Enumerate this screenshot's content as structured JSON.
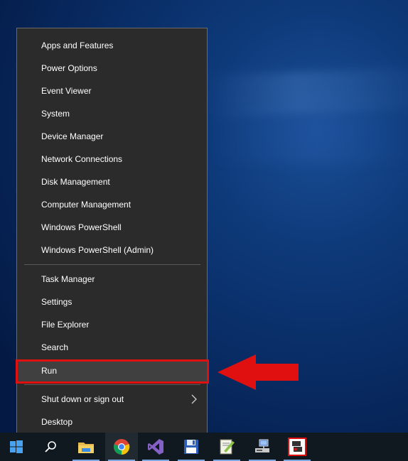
{
  "context_menu": {
    "items": [
      {
        "label": "Apps and Features"
      },
      {
        "label": "Power Options"
      },
      {
        "label": "Event Viewer"
      },
      {
        "label": "System"
      },
      {
        "label": "Device Manager"
      },
      {
        "label": "Network Connections"
      },
      {
        "label": "Disk Management"
      },
      {
        "label": "Computer Management"
      },
      {
        "label": "Windows PowerShell"
      },
      {
        "label": "Windows PowerShell (Admin)"
      },
      {
        "label": "Task Manager"
      },
      {
        "label": "Settings"
      },
      {
        "label": "File Explorer"
      },
      {
        "label": "Search"
      },
      {
        "label": "Run"
      },
      {
        "label": "Shut down or sign out"
      },
      {
        "label": "Desktop"
      }
    ],
    "highlighted_item": "Run",
    "submenu_icon": "chevron-right-icon"
  },
  "annotation": {
    "highlight_color": "#e01010",
    "arrow_icon": "red-left-arrow-icon"
  },
  "taskbar": {
    "buttons": [
      {
        "icon": "windows-start-icon"
      },
      {
        "icon": "search-icon"
      },
      {
        "icon": "file-explorer-icon"
      },
      {
        "icon": "chrome-icon"
      },
      {
        "icon": "visual-studio-icon"
      },
      {
        "icon": "save-floppy-icon"
      },
      {
        "icon": "notepad-plus-icon"
      },
      {
        "icon": "network-computer-icon"
      },
      {
        "icon": "remote-desktop-icon"
      }
    ]
  },
  "colors": {
    "menu_bg": "#2b2b2b",
    "menu_highlight": "#404040",
    "taskbar_bg": "#101820",
    "accent": "#7aa7e0"
  }
}
